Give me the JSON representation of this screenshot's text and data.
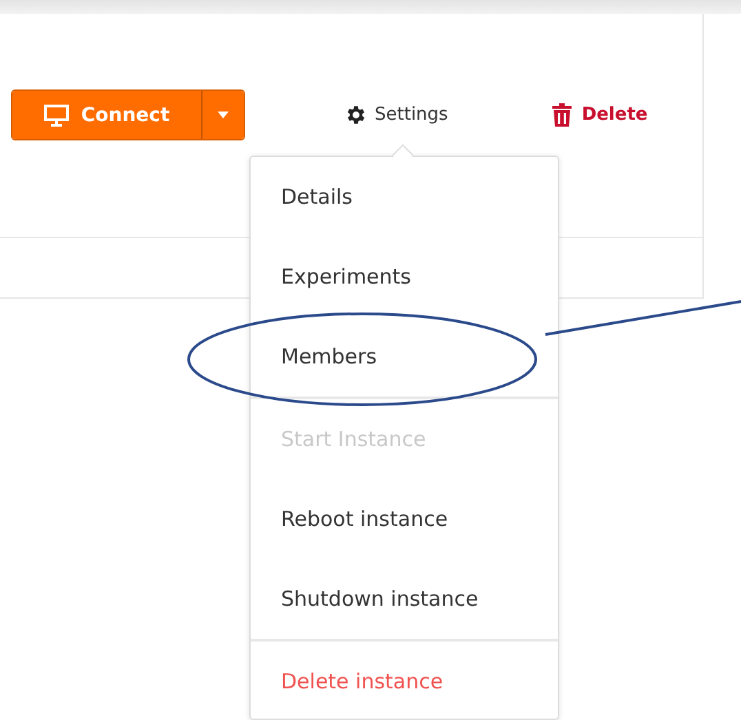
{
  "toolbar": {
    "connect": {
      "label": "Connect"
    },
    "settings": {
      "label": "Settings"
    },
    "delete": {
      "label": "Delete"
    }
  },
  "settings_menu": {
    "groups": [
      [
        {
          "label": "Details",
          "kind": "normal",
          "disabled": false
        },
        {
          "label": "Experiments",
          "kind": "normal",
          "disabled": false
        },
        {
          "label": "Members",
          "kind": "normal",
          "disabled": false
        }
      ],
      [
        {
          "label": "Start Instance",
          "kind": "normal",
          "disabled": true
        },
        {
          "label": "Reboot instance",
          "kind": "normal",
          "disabled": false
        },
        {
          "label": "Shutdown instance",
          "kind": "normal",
          "disabled": false
        }
      ],
      [
        {
          "label": "Delete instance",
          "kind": "danger",
          "disabled": false
        }
      ]
    ]
  }
}
